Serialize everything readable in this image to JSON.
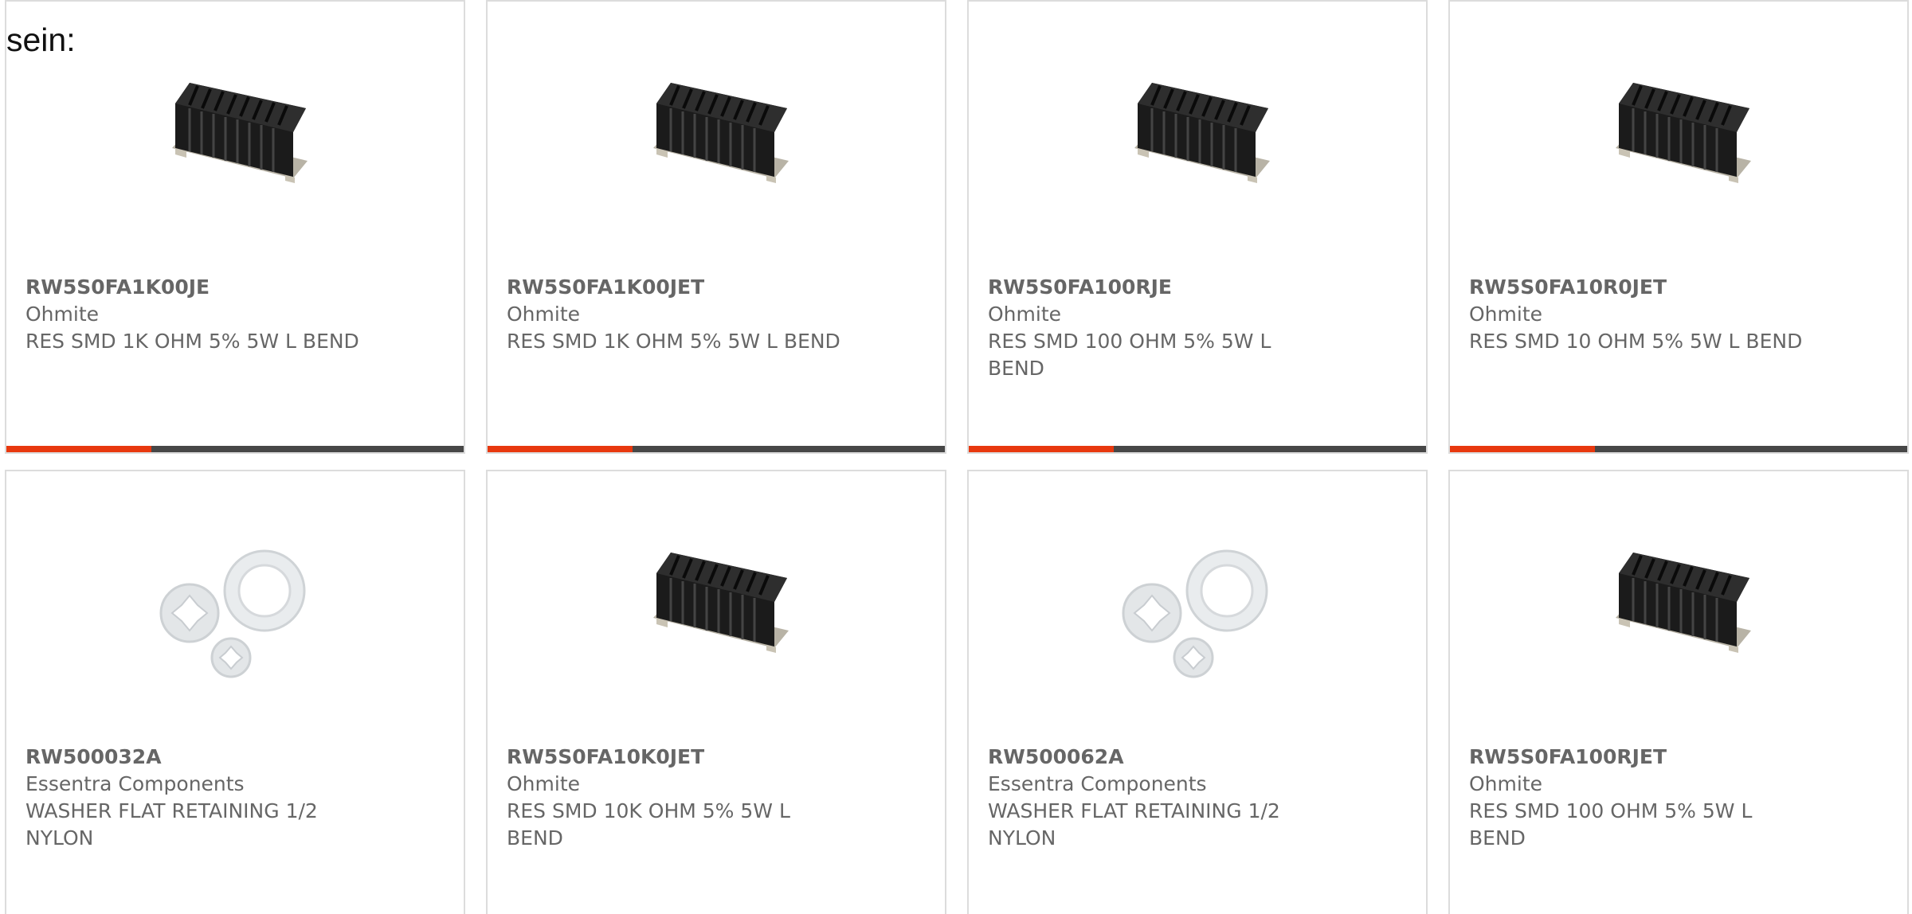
{
  "intro_text": "sein:",
  "colors": {
    "accent": "#e8380e",
    "bar": "#474747",
    "text": "#666666",
    "border": "#dcdcdc"
  },
  "products": [
    {
      "part": "RW5S0FA1K00JE",
      "manufacturer": "Ohmite",
      "description": "RES SMD 1K OHM 5% 5W L BEND",
      "image": "resistor-image"
    },
    {
      "part": "RW5S0FA1K00JET",
      "manufacturer": "Ohmite",
      "description": "RES SMD 1K OHM 5% 5W L BEND",
      "image": "resistor-image"
    },
    {
      "part": "RW5S0FA100RJE",
      "manufacturer": "Ohmite",
      "description": "RES SMD 100 OHM 5% 5W L BEND",
      "image": "resistor-image"
    },
    {
      "part": "RW5S0FA10R0JET",
      "manufacturer": "Ohmite",
      "description": "RES SMD 10 OHM 5% 5W L BEND",
      "image": "resistor-image"
    },
    {
      "part": "RW500032A",
      "manufacturer": "Essentra Components",
      "description": "WASHER FLAT RETAINING 1/2 NYLON",
      "image": "washer-image"
    },
    {
      "part": "RW5S0FA10K0JET",
      "manufacturer": "Ohmite",
      "description": "RES SMD 10K OHM 5% 5W L BEND",
      "image": "resistor-image"
    },
    {
      "part": "RW500062A",
      "manufacturer": "Essentra Components",
      "description": "WASHER FLAT RETAINING 1/2 NYLON",
      "image": "washer-image"
    },
    {
      "part": "RW5S0FA100RJET",
      "manufacturer": "Ohmite",
      "description": "RES SMD 100 OHM 5% 5W L BEND",
      "image": "resistor-image"
    }
  ]
}
